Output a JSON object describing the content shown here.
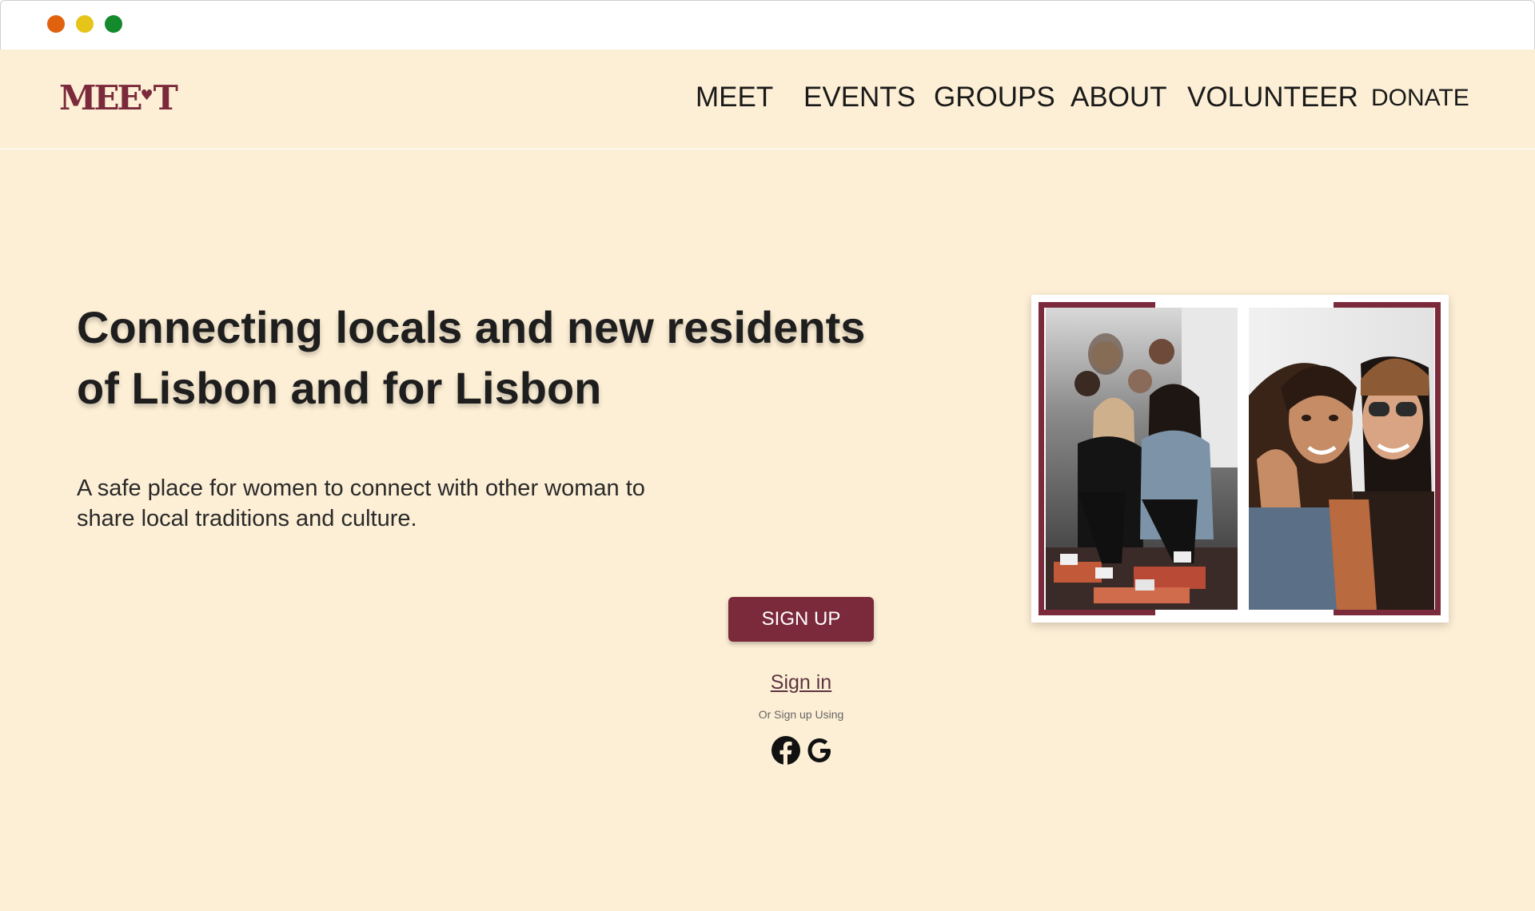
{
  "window": {
    "controls": [
      "close",
      "minimize",
      "maximize"
    ]
  },
  "brand": {
    "logo_left": "MEE",
    "logo_heart": "♥",
    "logo_right": "T",
    "color": "#7b2a3b",
    "background": "#fdefd5"
  },
  "nav": {
    "items": [
      "MEET",
      "EVENTS",
      "GROUPS",
      "ABOUT",
      "VOLUNTEER",
      "DONATE"
    ]
  },
  "hero": {
    "headline_line1": "Connecting locals and new residents",
    "headline_line2": "of Lisbon and for Lisbon",
    "subtitle_line1": "A safe place for women to connect with other woman to",
    "subtitle_line2": "share local traditions and culture."
  },
  "auth": {
    "signup_label": "SIGN UP",
    "signin_label": "Sign in",
    "or_text": "Or Sign up Using",
    "social_icons": [
      "facebook-icon",
      "google-icon"
    ]
  },
  "gallery": {
    "photos": [
      "group of women sitting on stairs",
      "two women smiling together"
    ]
  }
}
